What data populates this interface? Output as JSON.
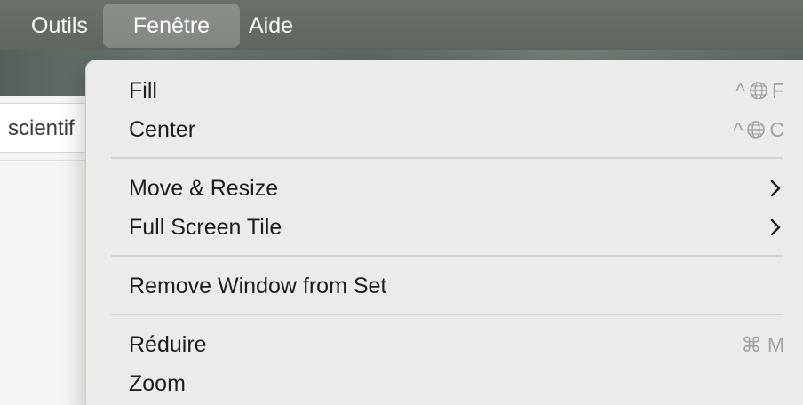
{
  "menubar": {
    "items": [
      {
        "label": "Outils"
      },
      {
        "label": "Fenêtre"
      },
      {
        "label": "Aide"
      }
    ]
  },
  "app": {
    "search_text": "scientif"
  },
  "menu": {
    "fill": {
      "label": "Fill",
      "shortcut_ctrl": "^",
      "shortcut_key": "F"
    },
    "center": {
      "label": "Center",
      "shortcut_ctrl": "^",
      "shortcut_key": "C"
    },
    "move_resize": {
      "label": "Move & Resize"
    },
    "full_screen_tile": {
      "label": "Full Screen Tile"
    },
    "remove_window": {
      "label": "Remove Window from Set"
    },
    "reduire": {
      "label": "Réduire",
      "shortcut": "⌘ M"
    },
    "zoom": {
      "label": "Zoom"
    }
  },
  "colors": {
    "menu_background": "#ebebea",
    "menubar_background": "#646b63",
    "shortcut_text": "#a3a3a3"
  }
}
